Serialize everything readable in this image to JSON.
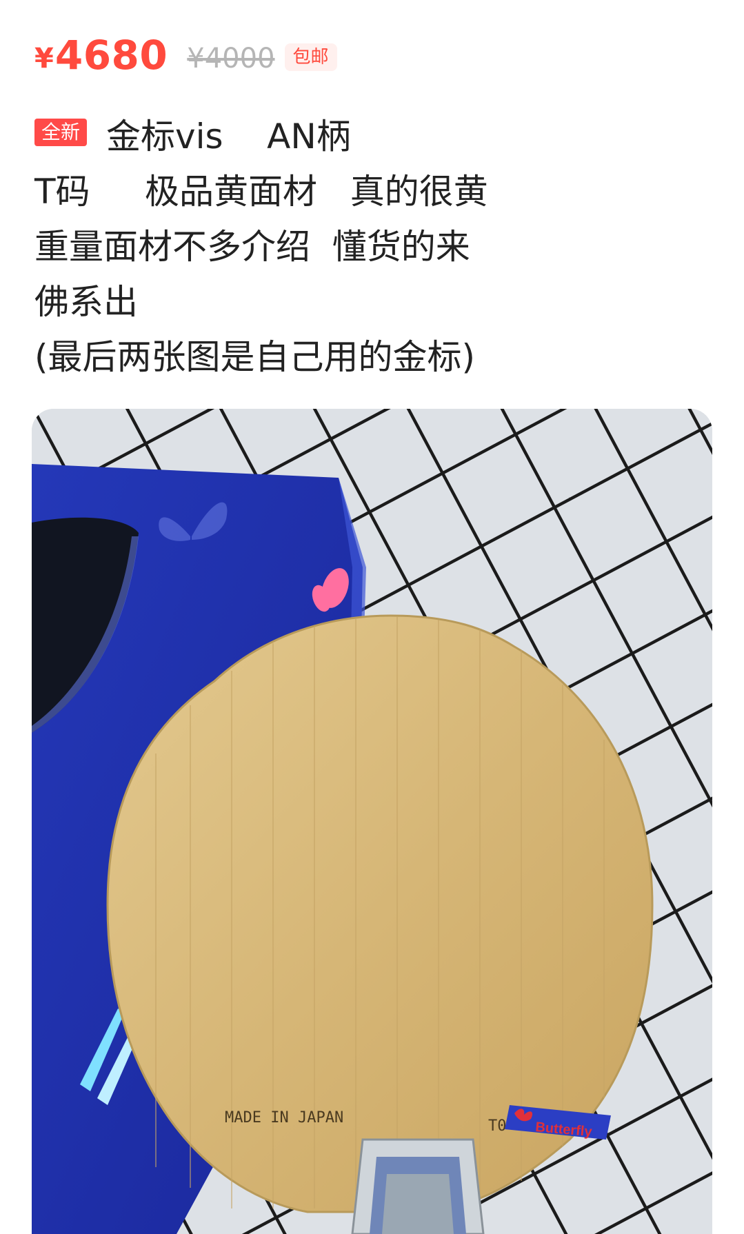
{
  "price": {
    "currency": "¥",
    "amount": "4680",
    "original": "¥4000",
    "shipping_badge": "包邮"
  },
  "description": {
    "condition_badge": "全新",
    "lines": [
      "金标vis    AN柄",
      "T码     极品黄面材   真的很黄",
      "重量面材不多介绍  懂货的来",
      "佛系出",
      "(最后两张图是自己用的金标)"
    ]
  },
  "photo": {
    "blade_stamp": "MADE IN JAPAN",
    "code_mark": "T0",
    "brand_label": "Butterfly",
    "box_color": "#1a2fa8",
    "blade_color": "#d8b97a",
    "cloth_color": "#dde1e6"
  }
}
